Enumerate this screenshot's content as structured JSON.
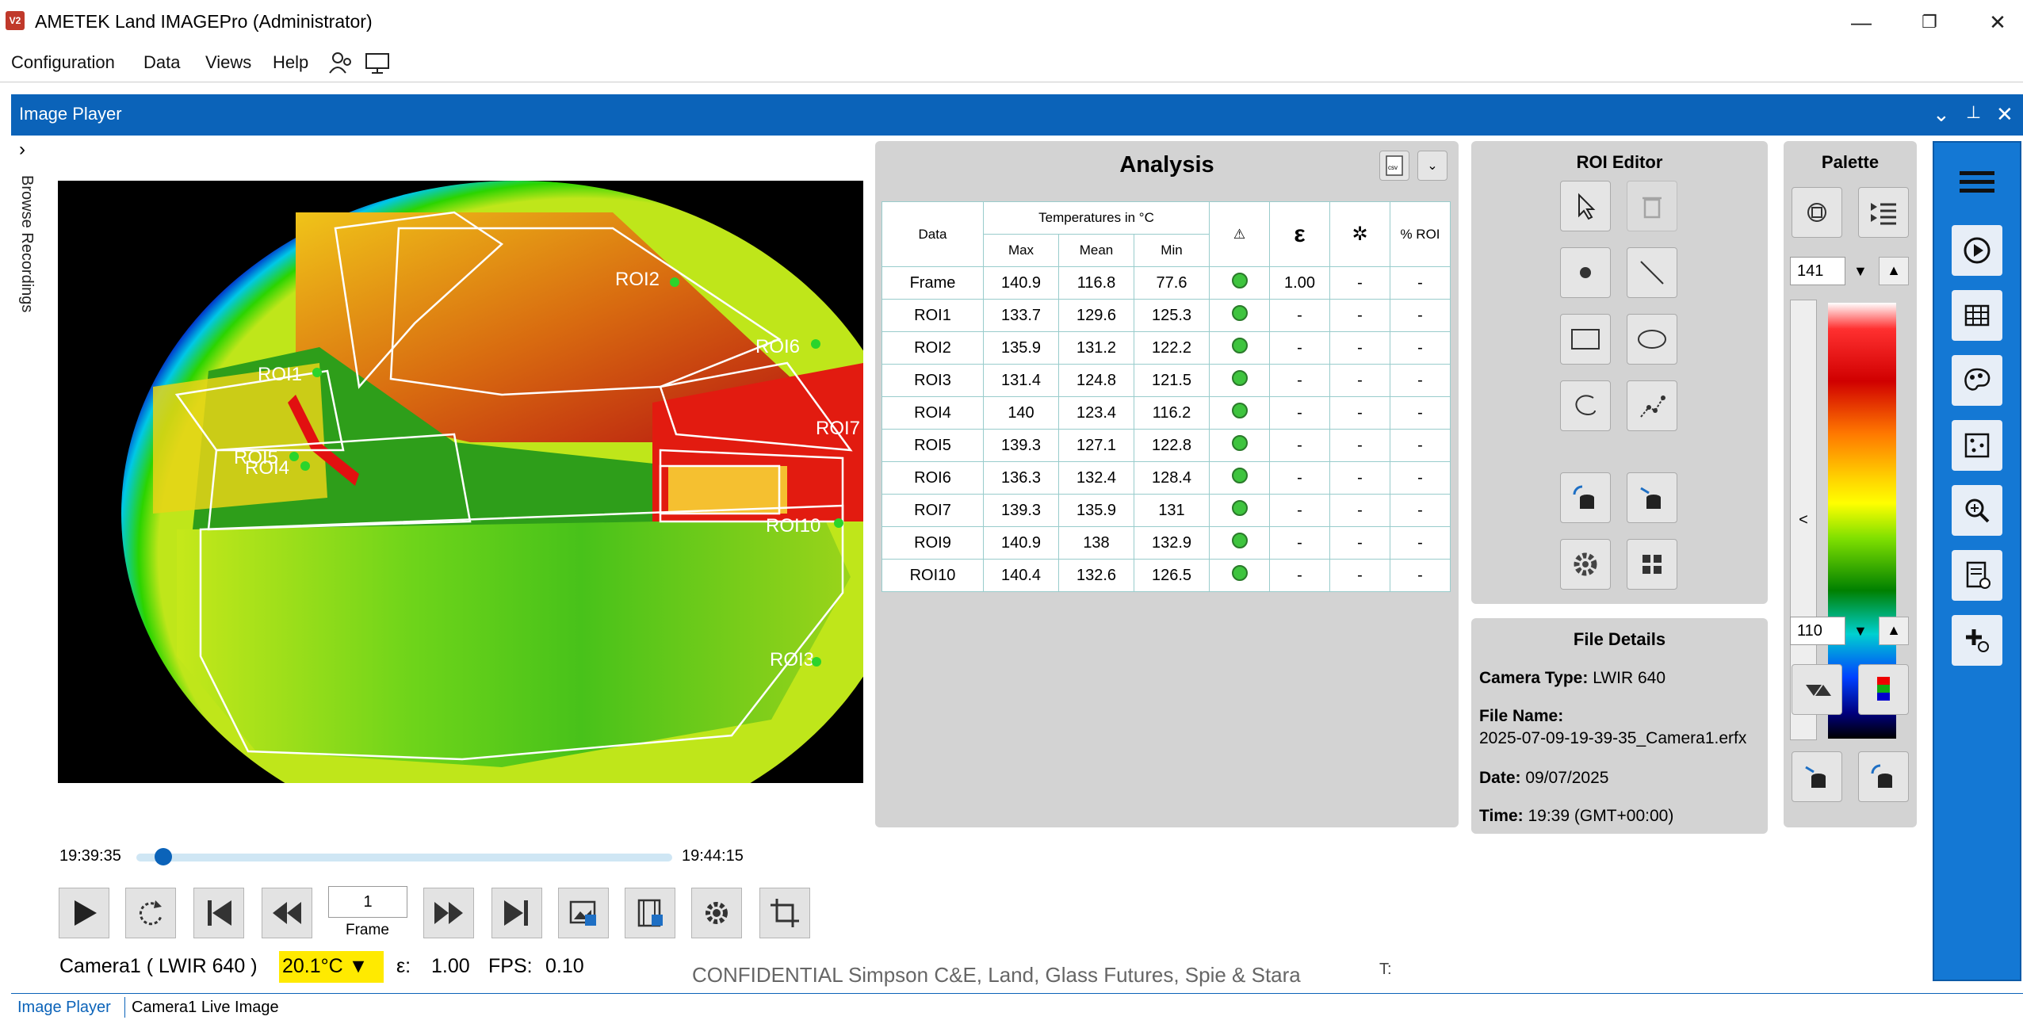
{
  "window": {
    "title": "AMETEK Land IMAGEPro (Administrator)",
    "icon_text": "V2"
  },
  "menu": [
    "Configuration",
    "Data",
    "Views",
    "Help"
  ],
  "panel": {
    "title": "Image Player",
    "side_label": "Browse Recordings"
  },
  "thermal": {
    "roi_labels": [
      "ROI1",
      "ROI2",
      "ROI3",
      "ROI4",
      "ROI5",
      "ROI6",
      "ROI7",
      "ROI10"
    ]
  },
  "timeline": {
    "start": "19:39:35",
    "end": "19:44:15",
    "progress": 0.05
  },
  "controls": {
    "frame_value": "1",
    "frame_label": "Frame"
  },
  "status": {
    "camera": "Camera1 ( LWIR 640 )",
    "temp": "20.1°C ▼",
    "eps_label": "ε:",
    "eps": "1.00",
    "fps_label": "FPS:",
    "fps": "0.10",
    "t_label": "T:",
    "confidential": "CONFIDENTIAL Simpson C&E, Land, Glass Futures, Spie & Stara"
  },
  "bottom_tabs": [
    "Image Player",
    "Camera1 Live Image"
  ],
  "analysis": {
    "title": "Analysis",
    "h_data": "Data",
    "h_temps": "Temperatures in °C",
    "h_max": "Max",
    "h_mean": "Mean",
    "h_min": "Min",
    "h_eps": "ε",
    "h_roi": "% ROI",
    "rows": [
      [
        "Frame",
        "140.9",
        "116.8",
        "77.6",
        "1.00",
        "-",
        "-"
      ],
      [
        "ROI1",
        "133.7",
        "129.6",
        "125.3",
        "-",
        "-",
        "-"
      ],
      [
        "ROI2",
        "135.9",
        "131.2",
        "122.2",
        "-",
        "-",
        "-"
      ],
      [
        "ROI3",
        "131.4",
        "124.8",
        "121.5",
        "-",
        "-",
        "-"
      ],
      [
        "ROI4",
        "140",
        "123.4",
        "116.2",
        "-",
        "-",
        "-"
      ],
      [
        "ROI5",
        "139.3",
        "127.1",
        "122.8",
        "-",
        "-",
        "-"
      ],
      [
        "ROI6",
        "136.3",
        "132.4",
        "128.4",
        "-",
        "-",
        "-"
      ],
      [
        "ROI7",
        "139.3",
        "135.9",
        "131",
        "-",
        "-",
        "-"
      ],
      [
        "ROI9",
        "140.9",
        "138",
        "132.9",
        "-",
        "-",
        "-"
      ],
      [
        "ROI10",
        "140.4",
        "132.6",
        "126.5",
        "-",
        "-",
        "-"
      ]
    ]
  },
  "roi_editor": {
    "title": "ROI Editor"
  },
  "file_details": {
    "title": "File Details",
    "camera_type_label": "Camera Type:",
    "camera_type": "LWIR 640",
    "file_name_label": "File Name:",
    "file_name": "2025-07-09-19-39-35_Camera1.erfx",
    "date_label": "Date:",
    "date": "09/07/2025",
    "time_label": "Time:",
    "time": "19:39 (GMT+00:00)"
  },
  "palette": {
    "title": "Palette",
    "max": "141",
    "min": "110",
    "collapse": "<"
  }
}
